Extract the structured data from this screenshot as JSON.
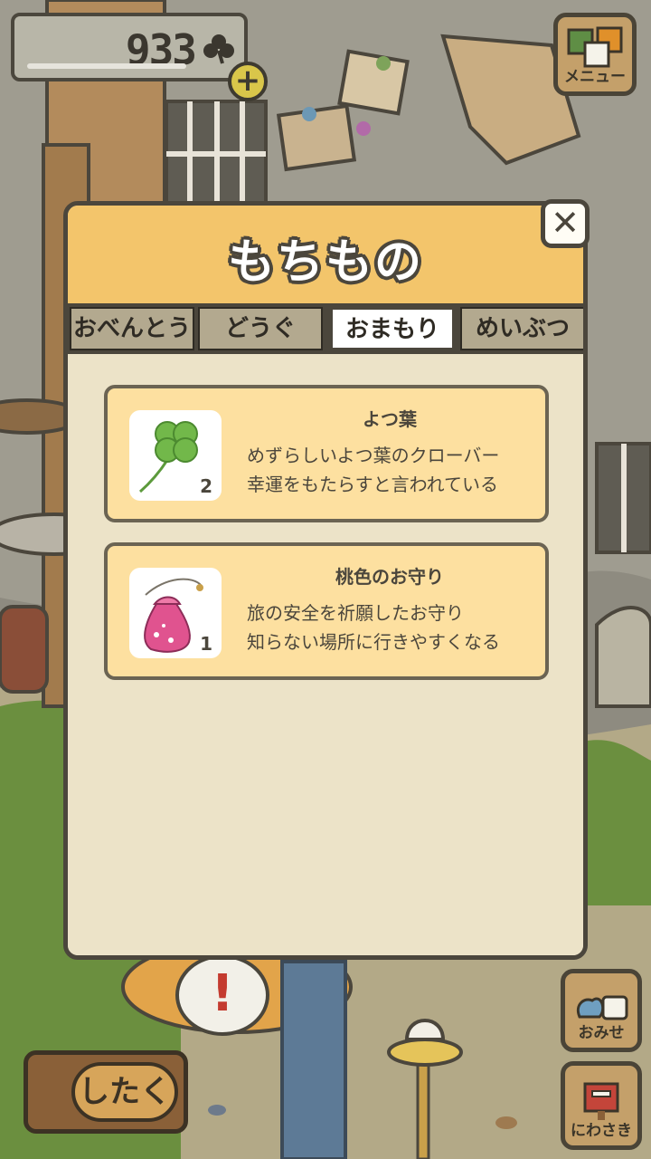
{
  "hud": {
    "clover_count": "933",
    "plus_symbol": "+",
    "menu_label": "メニュー",
    "shop_label": "おみせ",
    "garden_label": "にわさき",
    "prepare_label": "したく",
    "alert_symbol": "!"
  },
  "modal": {
    "title": "もちもの",
    "close_symbol": "✕",
    "tabs": [
      {
        "label": "おべんとう",
        "active": false
      },
      {
        "label": "どうぐ",
        "active": false
      },
      {
        "label": "おまもり",
        "active": true
      },
      {
        "label": "めいぶつ",
        "active": false
      }
    ],
    "items": [
      {
        "name": "よつ葉",
        "count": "2",
        "line1": "めずらしいよつ葉のクローバー",
        "line2": "幸運をもたらすと言われている",
        "icon": "four-leaf-clover-icon"
      },
      {
        "name": "桃色のお守り",
        "count": "1",
        "line1": "旅の安全を祈願したお守り",
        "line2": "知らない場所に行きやすくなる",
        "icon": "pink-charm-pouch-icon"
      }
    ]
  },
  "colors": {
    "header": "#f3c56b",
    "card": "#fde0a0",
    "panel": "#ece3c8",
    "outline": "#4b463c"
  }
}
